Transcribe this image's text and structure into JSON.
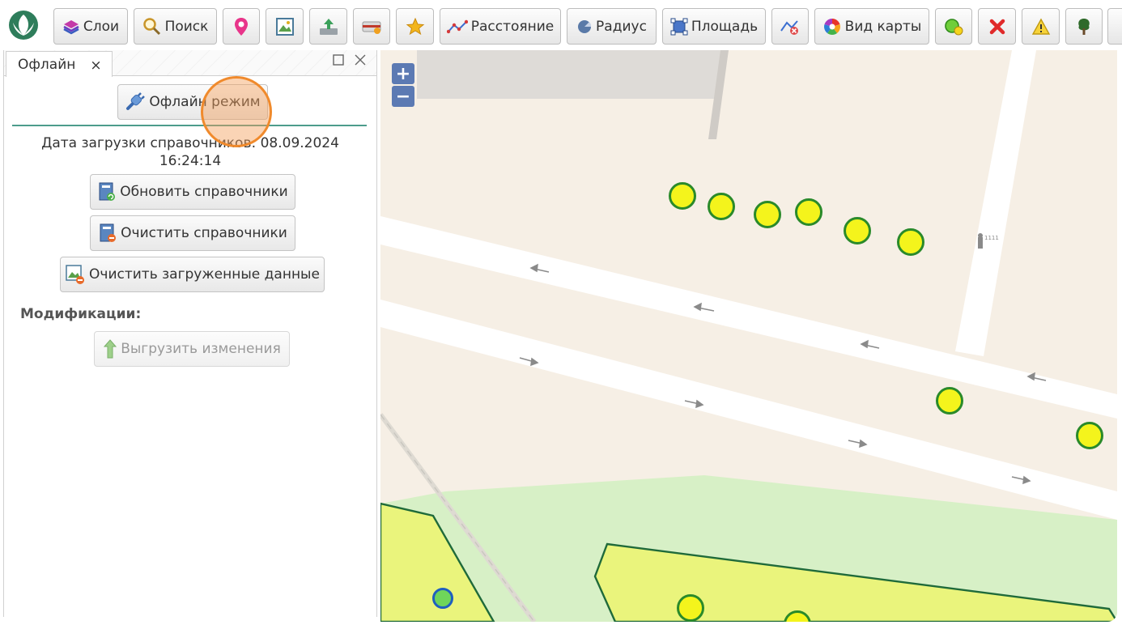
{
  "toolbar": {
    "layers_label": "Слои",
    "search_label": "Поиск",
    "distance_label": "Расстояние",
    "radius_label": "Радиус",
    "area_label": "Площадь",
    "map_view_label": "Вид карты"
  },
  "panel": {
    "tab_label": "Офлайн",
    "tab_close": "×",
    "offline_mode_label": "Офлайн режим",
    "download_date_label": "Дата загрузки справочников: 08.09.2024",
    "download_time": "16:24:14",
    "update_refs_label": "Обновить справочники",
    "clear_refs_label": "Очистить справочники",
    "clear_data_label": "Очистить загруженные данные",
    "modifications_heading": "Модификации:",
    "upload_changes_label": "Выгрузить изменения"
  },
  "map": {
    "zoom_in": "+",
    "zoom_out": "−"
  },
  "colors": {
    "marker_fill": "#f4f41c",
    "marker_stroke": "#2a8a2a",
    "accent_line": "#4d9c8c",
    "zoom_button": "#5c7ab3",
    "cursor_highlight": "#f08a2c"
  }
}
